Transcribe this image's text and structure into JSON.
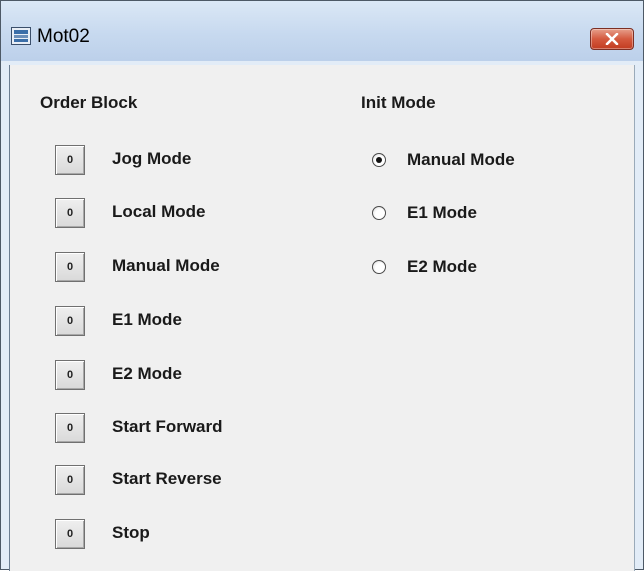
{
  "window": {
    "title": "Mot02",
    "close_icon": "close-icon",
    "app_icon": "motor-window-icon"
  },
  "order_block": {
    "heading": "Order Block",
    "buttons": [
      {
        "value": "0",
        "label": "Jog Mode"
      },
      {
        "value": "0",
        "label": "Local Mode"
      },
      {
        "value": "0",
        "label": "Manual Mode"
      },
      {
        "value": "0",
        "label": "E1 Mode"
      },
      {
        "value": "0",
        "label": "E2 Mode"
      },
      {
        "value": "0",
        "label": "Start Forward"
      },
      {
        "value": "0",
        "label": "Start Reverse"
      },
      {
        "value": "0",
        "label": "Stop"
      }
    ]
  },
  "init_mode": {
    "heading": "Init Mode",
    "options": [
      {
        "label": "Manual Mode",
        "checked": true
      },
      {
        "label": "E1 Mode",
        "checked": false
      },
      {
        "label": "E2 Mode",
        "checked": false
      }
    ]
  },
  "colors": {
    "titlebar": "#c7d9ef",
    "close_button": "#d4593e",
    "panel": "#f0f0f0"
  }
}
